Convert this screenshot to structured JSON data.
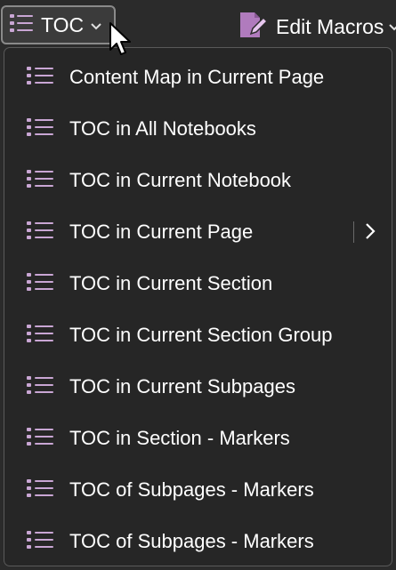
{
  "toolbar": {
    "toc_button": {
      "label": "TOC",
      "icon": "list-icon",
      "dropdown_icon": "chevron-down-icon"
    },
    "edit_macros": {
      "label": "Edit Macros",
      "icon": "edit-macro-icon",
      "dropdown_icon": "chevron-down-icon"
    }
  },
  "menu": {
    "items": [
      {
        "label": "Content Map in Current Page",
        "icon": "list-icon",
        "has_submenu": false
      },
      {
        "label": "TOC in All Notebooks",
        "icon": "list-icon",
        "has_submenu": false
      },
      {
        "label": "TOC in Current Notebook",
        "icon": "list-icon",
        "has_submenu": false
      },
      {
        "label": "TOC in Current Page",
        "icon": "list-icon",
        "has_submenu": true
      },
      {
        "label": "TOC in Current Section",
        "icon": "list-icon",
        "has_submenu": false
      },
      {
        "label": "TOC in Current Section Group",
        "icon": "list-icon",
        "has_submenu": false
      },
      {
        "label": "TOC in Current Subpages",
        "icon": "list-icon",
        "has_submenu": false
      },
      {
        "label": "TOC in Section - Markers",
        "icon": "list-icon",
        "has_submenu": false
      },
      {
        "label": "TOC of Subpages - Markers",
        "icon": "list-icon",
        "has_submenu": false
      },
      {
        "label": "TOC of Subpages - Markers",
        "icon": "list-icon",
        "has_submenu": false
      }
    ]
  },
  "colors": {
    "background": "#2b2b2b",
    "menu_background": "#262626",
    "icon_accent": "#c9a6d4",
    "text": "#ffffff"
  }
}
